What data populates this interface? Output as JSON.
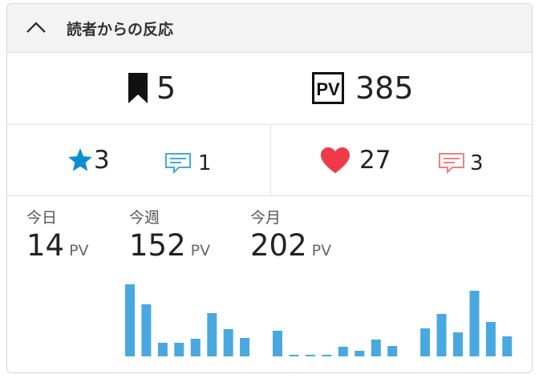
{
  "header": {
    "title": "読者からの反応"
  },
  "stats": {
    "bookmarks": "5",
    "pv_icon_text": "PV",
    "pv": "385",
    "stars": "3",
    "star_comments": "1",
    "likes": "27",
    "like_comments": "3"
  },
  "access": {
    "today_label": "今日",
    "today_value": "14",
    "today_unit": "PV",
    "week_label": "今週",
    "week_value": "152",
    "week_unit": "PV",
    "month_label": "今月",
    "month_value": "202",
    "month_unit": "PV"
  },
  "colors": {
    "accent_blue": "#0a90d2",
    "bar_blue": "#4aa8e0",
    "heart_red": "#ee3b47",
    "comment_red": "#f08080"
  },
  "chart_data": {
    "type": "bar",
    "values": [
      90,
      65,
      17,
      17,
      22,
      54,
      34,
      23,
      0,
      32,
      2,
      2,
      2,
      12,
      7,
      21,
      13,
      0,
      35,
      53,
      30,
      82,
      43,
      25
    ]
  }
}
